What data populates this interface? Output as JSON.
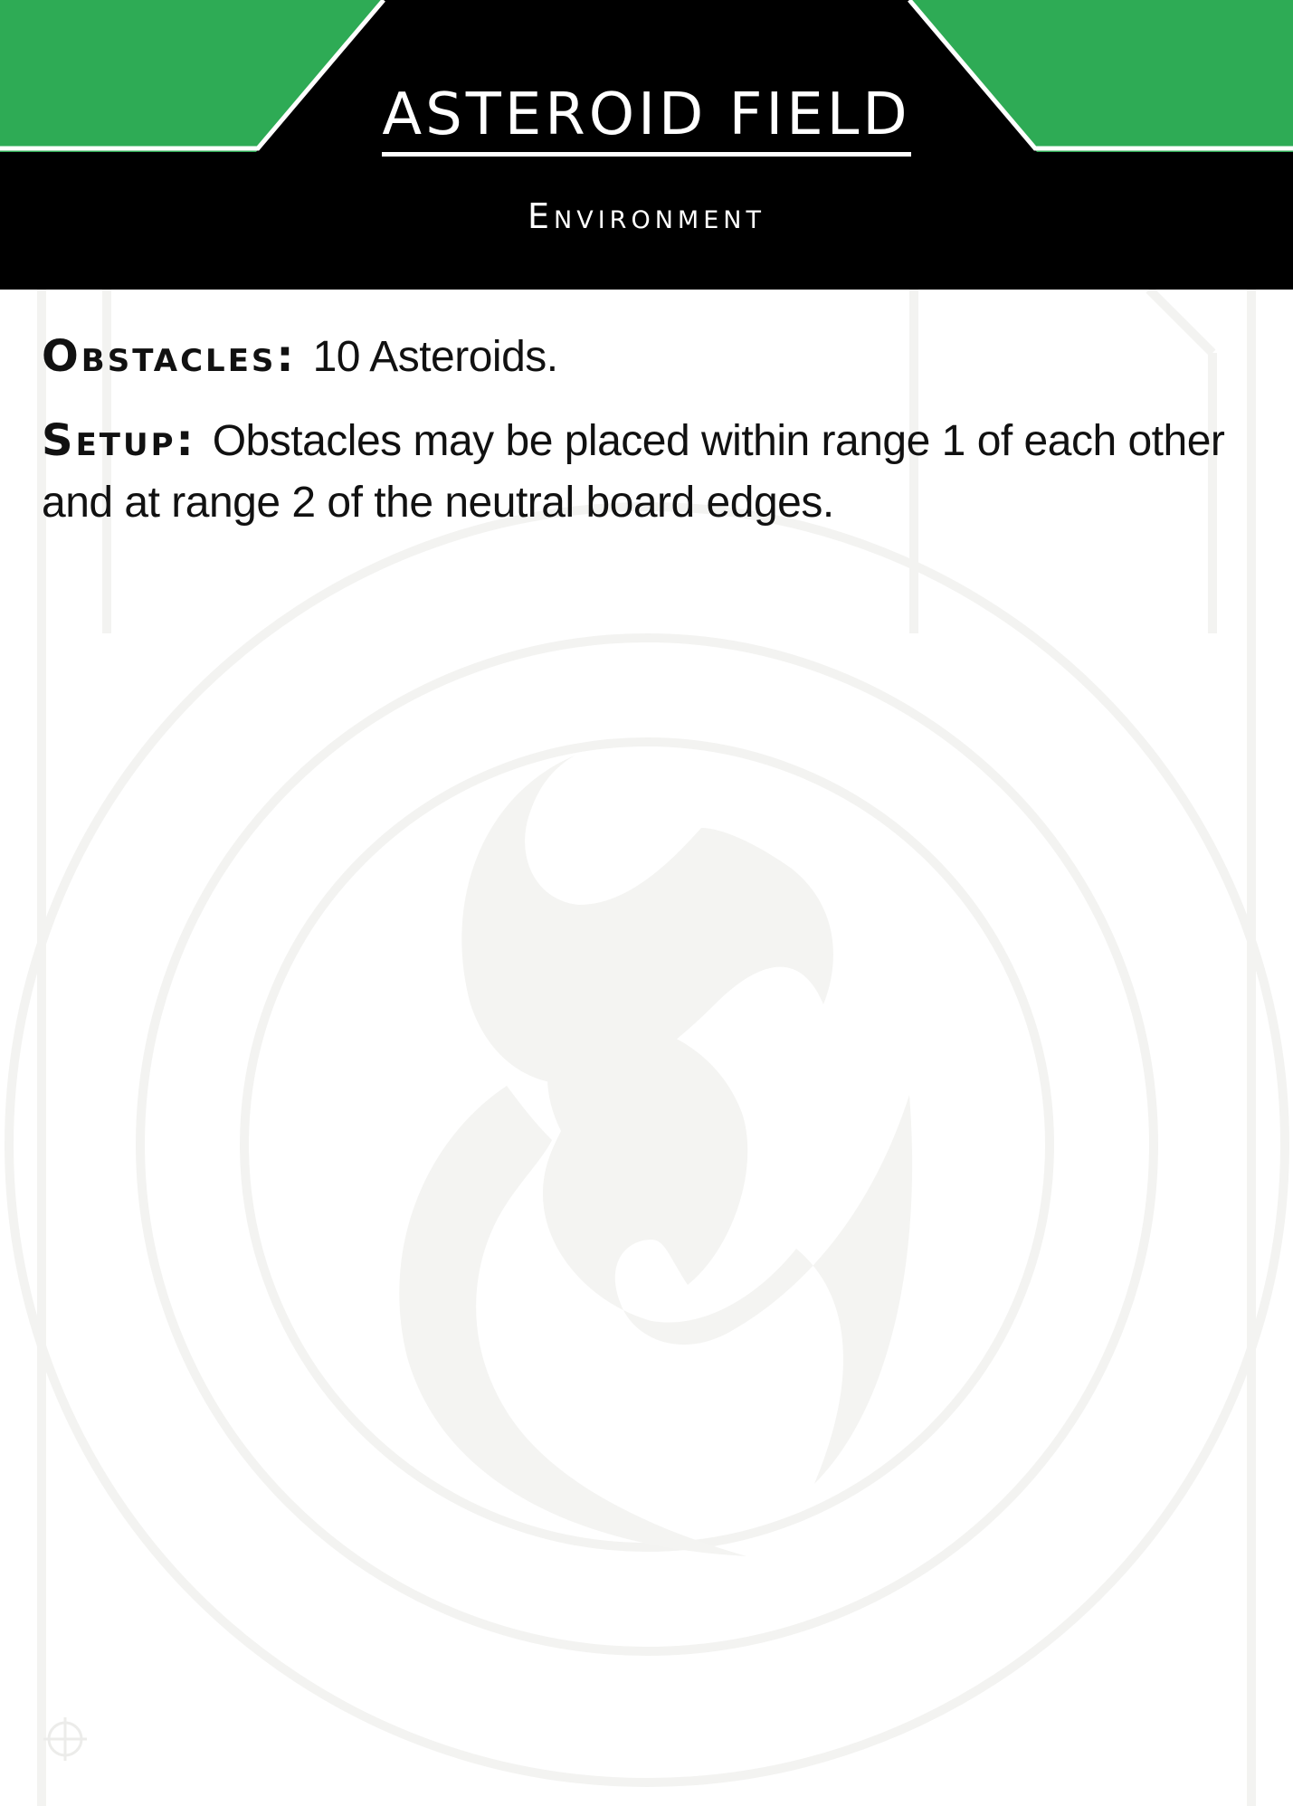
{
  "card": {
    "title": "ASTEROID FIELD",
    "subtitle": "Environment",
    "colors": {
      "accent": "#2eab55",
      "header": "#000000",
      "text": "#111111",
      "watermark": "#f2f2f0"
    },
    "watermark_icon": "faction-emblem-icon",
    "corner_icon": "set-symbol-icon"
  },
  "rules": [
    {
      "label": "Obstacles:",
      "text": "10 Asteroids."
    },
    {
      "label": "Setup:",
      "text": "Obstacles may be placed within range 1 of each other and at range 2 of the neutral board edges."
    }
  ]
}
